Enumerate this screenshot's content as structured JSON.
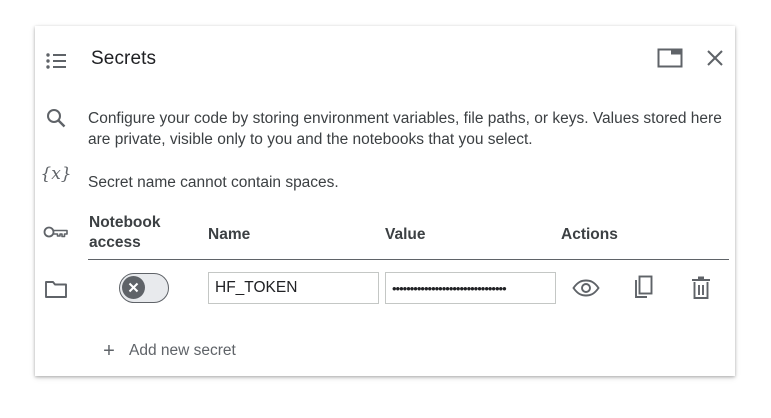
{
  "panel": {
    "title": "Secrets",
    "description": "Configure your code by storing environment variables, file paths, or keys. Values stored here are private, visible only to you and the notebooks that you select.",
    "note": "Secret name cannot contain spaces."
  },
  "rail": {
    "icons": [
      "toc-icon",
      "search-icon",
      "variables-icon",
      "key-icon",
      "folder-icon"
    ],
    "variables_glyph": "{x}"
  },
  "header_icons": [
    "open-in-tab-icon",
    "close-icon"
  ],
  "table": {
    "headers": {
      "access_line1": "Notebook",
      "access_line2": "access",
      "name": "Name",
      "value": "Value",
      "actions": "Actions"
    },
    "rows": [
      {
        "notebook_access": false,
        "name": "HF_TOKEN",
        "value": "••••••••••••••••••••••••••••••••"
      }
    ]
  },
  "add_secret_label": "Add new secret",
  "colors": {
    "icon": "#5f6368",
    "text": "#202124",
    "border": "#c4c7c5"
  }
}
